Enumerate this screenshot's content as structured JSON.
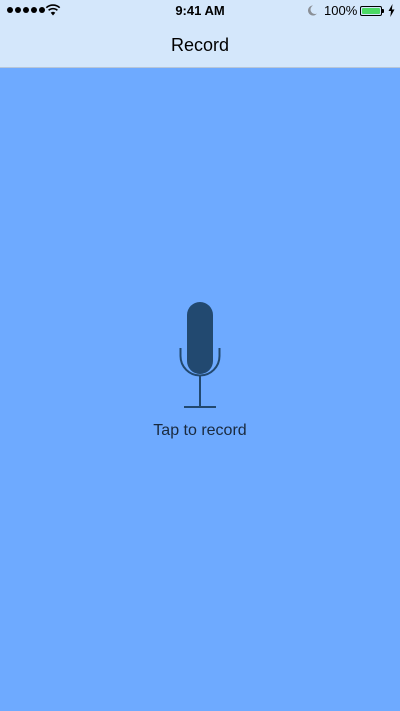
{
  "status_bar": {
    "time": "9:41 AM",
    "battery_percent": "100%",
    "battery_level": 1.0,
    "signal_bars": 5,
    "icons": [
      "signal-icon",
      "wifi-icon",
      "moon-icon",
      "battery-icon",
      "charging-bolt-icon"
    ],
    "battery_color": "#4cd964"
  },
  "nav": {
    "title": "Record"
  },
  "recorder": {
    "prompt": "Tap to record",
    "icon": "microphone-icon"
  },
  "colors": {
    "background": "#6eaaff",
    "nav_background": "#d4e7fb",
    "mic_color": "#224970"
  }
}
